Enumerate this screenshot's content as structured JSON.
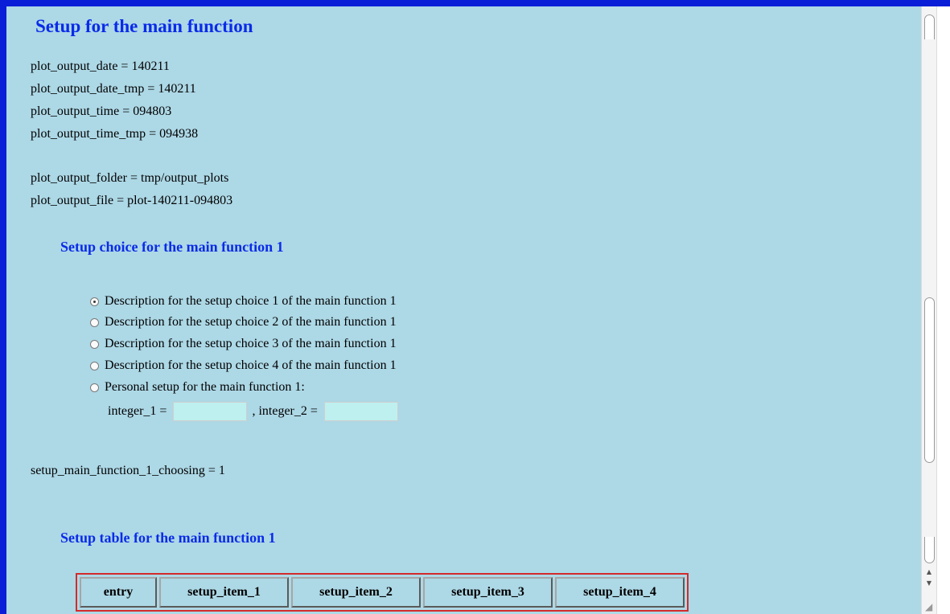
{
  "main_title": "Setup for the main function",
  "variables": [
    "plot_output_date = 140211",
    "plot_output_date_tmp = 140211",
    "plot_output_time = 094803",
    "plot_output_time_tmp = 094938",
    "plot_output_folder = tmp/output_plots",
    "plot_output_file = plot-140211-094803"
  ],
  "choice_title": "Setup choice for the main function 1",
  "choices": [
    {
      "label": "Description for the setup choice 1 of the main function 1",
      "checked": true
    },
    {
      "label": "Description for the setup choice 2 of the main function 1",
      "checked": false
    },
    {
      "label": "Description for the setup choice 3 of the main function 1",
      "checked": false
    },
    {
      "label": "Description for the setup choice 4 of the main function 1",
      "checked": false
    },
    {
      "label": "Personal setup for the main function 1:",
      "checked": false
    }
  ],
  "personal": {
    "integer_1_label": "integer_1 =",
    "integer_1_value": "",
    "integer_2_label": ", integer_2 =",
    "integer_2_value": ""
  },
  "choosing_line": "setup_main_function_1_choosing = 1",
  "table_title": "Setup table for the main function 1",
  "table_headers": [
    "entry",
    "setup_item_1",
    "setup_item_2",
    "setup_item_3",
    "setup_item_4"
  ],
  "colors": {
    "background": "#add8e6",
    "heading": "#0a2be8",
    "frame": "#0a1ed8",
    "table_border": "#d32a2a",
    "input_bg": "#bdf0ef"
  },
  "icons": {
    "radio_checked": "radio-checked-icon",
    "radio_unchecked": "radio-unchecked-icon",
    "scroll_up": "arrow-up-icon",
    "scroll_down": "arrow-down-icon",
    "resize": "resize-grip-icon"
  }
}
